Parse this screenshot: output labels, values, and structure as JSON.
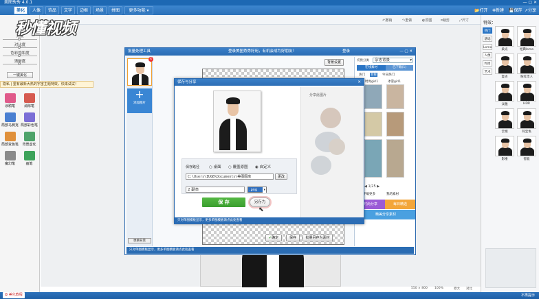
{
  "app": {
    "title": "美图秀秀 4.0.1"
  },
  "menu": {
    "tabs": [
      "美化",
      "人像",
      "饰品",
      "文字",
      "边框",
      "场景",
      "拼图",
      "更多功能 ▾"
    ],
    "right_items": [
      "打开",
      "新建",
      "保存",
      "分享"
    ]
  },
  "toolbar": {
    "items": [
      "撤销",
      "重做",
      "原图",
      "裁剪",
      "尺寸"
    ],
    "left_tab": "基础"
  },
  "logo": {
    "text": "秒懂视频"
  },
  "left_panel": {
    "brightness_label": "亮度",
    "contrast_label": "对比度",
    "saturation_label": "色彩饱和度",
    "sharpen_label": "清晰度",
    "auto_button": "一键美化",
    "tools": [
      "涂鸦笔",
      "消除笔",
      "局部马赛克",
      "局部彩色笔",
      "局部变色笔",
      "背景虚化",
      "魔幻笔",
      "画笔"
    ]
  },
  "notice": {
    "text": "隐私 | 里有最新大热的宇宙主题特效，快来试试！"
  },
  "batch_window": {
    "title": "批量处理工具",
    "banner": "登录美图秀秀好用，有机会成为好朋友！",
    "login": "登录",
    "bg_settings": "背景设置",
    "add_image": "添加图片",
    "change_bg": "更换背景",
    "ok_button": "确定",
    "save_button": "保存",
    "save_as_button": "批量另存为素材",
    "footer_hint": "只对单图模板显示，更多单图模板请点此处查看"
  },
  "save_dialog": {
    "title": "保存与分享",
    "share_label": "分享此图片",
    "path_label": "保存路径",
    "radio_desktop": "桌面",
    "radio_overwrite": "覆盖原图",
    "radio_custom": "自定义",
    "path_value": "C:\\Users\\IUGB\\Documents\\美图图库",
    "change_btn": "更改",
    "filename": "2 副本",
    "format": ".png",
    "save_btn": "保 存",
    "save_as_btn": "另存为",
    "footer": "只对单图模板显示，更多单图模板请点此处查看"
  },
  "material_panel": {
    "header": "切换分类",
    "category": "杂志背景",
    "tabs": [
      "在线素材",
      "已下载(1)"
    ],
    "subtabs": [
      "热门",
      "新鲜",
      "今日热门"
    ],
    "labels": [
      "时尚girl1",
      "冰雪girl1"
    ],
    "page": "1/25",
    "download_more": "下载更多",
    "my_material": "我的素材",
    "banner1": "时尚分享",
    "banner2": "每日精选",
    "banner3": "精美分享素材"
  },
  "right_panel": {
    "title": "特效：",
    "tabs": [
      "热门",
      "基础",
      "Lomo",
      "人像",
      "时尚",
      "艺术"
    ],
    "effects": [
      "柔光",
      "经典lomo",
      "复古",
      "粉红佳人",
      "淡雅",
      "HDR",
      "云端",
      "阿宝色",
      "影楼",
      "智能"
    ]
  },
  "status": {
    "tutorial": "美化教程",
    "size": "550 × 800",
    "zoom": "100%",
    "fit": "原大",
    "compare": "对比",
    "bottom_right": "不再提示"
  },
  "colors": {
    "accent": "#1d68b3",
    "save_green": "#3a9e2f",
    "purple": "#9b5bd6"
  }
}
